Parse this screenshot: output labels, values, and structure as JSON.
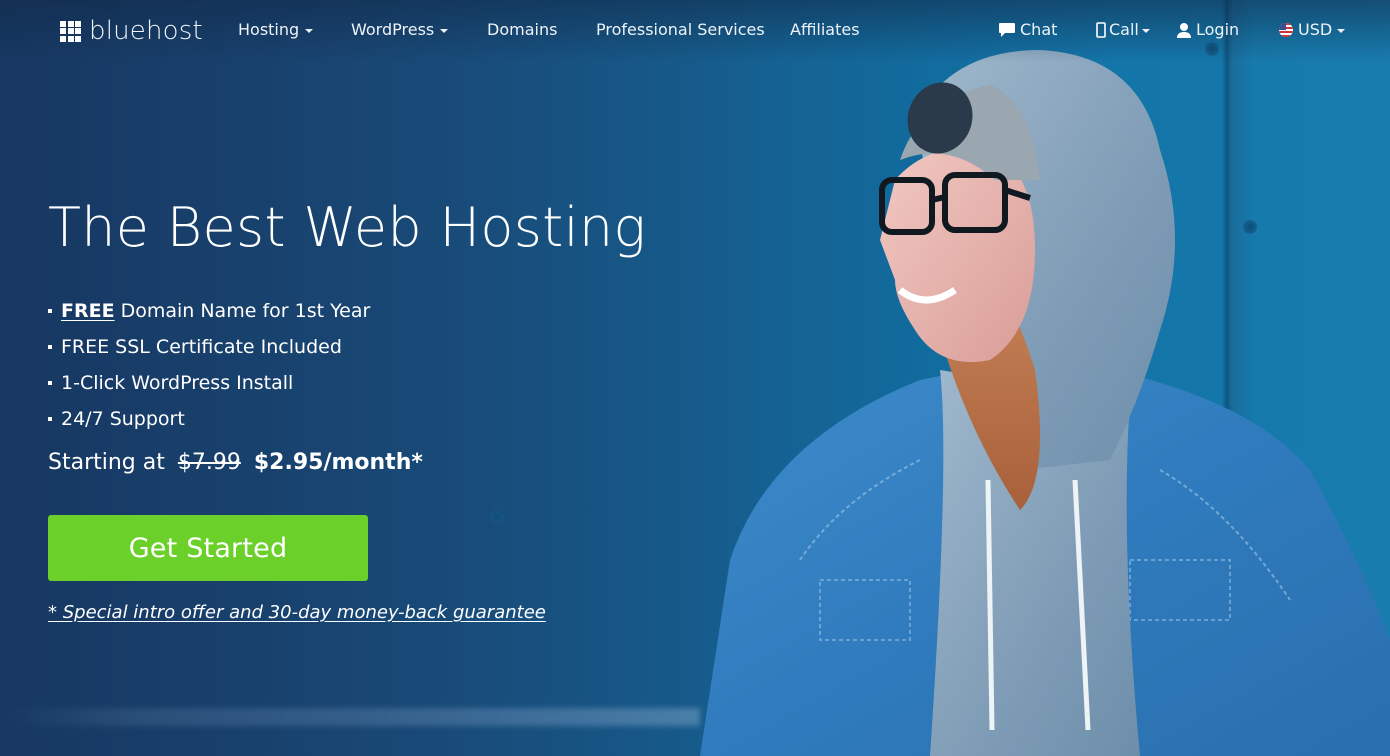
{
  "brand": {
    "name": "bluehost",
    "logo_icon": "grid-3x3-icon"
  },
  "nav": {
    "left_items": [
      {
        "label": "Hosting",
        "has_dropdown": true
      },
      {
        "label": "WordPress",
        "has_dropdown": true
      },
      {
        "label": "Domains",
        "has_dropdown": false
      },
      {
        "label": "Professional Services",
        "has_dropdown": false
      },
      {
        "label": "Affiliates",
        "has_dropdown": false
      }
    ],
    "right_items": [
      {
        "label": "Chat",
        "icon": "chat-bubble-icon",
        "has_dropdown": false
      },
      {
        "label": "Call",
        "icon": "phone-icon",
        "has_dropdown": true
      },
      {
        "label": "Login",
        "icon": "user-icon",
        "has_dropdown": false
      },
      {
        "label": "USD",
        "icon": "us-flag-icon",
        "has_dropdown": true
      }
    ]
  },
  "hero": {
    "title": "The Best Web Hosting",
    "features": [
      {
        "strong": "FREE",
        "text": "Domain Name for 1st Year"
      },
      {
        "strong": "",
        "text": "FREE SSL Certificate Included"
      },
      {
        "strong": "",
        "text": "1-Click WordPress Install"
      },
      {
        "strong": "",
        "text": "24/7 Support"
      }
    ],
    "price": {
      "prefix": "Starting at",
      "old_price": "$7.99",
      "new_price": "$2.95/month*"
    },
    "cta_label": "Get Started",
    "offer_link": "* Special intro offer and 30-day money-back guarantee",
    "image_alt": "Smiling woman in grey hoodie, beanie, glasses and denim jacket against blue wall"
  },
  "colors": {
    "background_dark": "#183c66",
    "background_light": "#1478ab",
    "cta_green": "#6cd02a",
    "text": "#ffffff"
  }
}
